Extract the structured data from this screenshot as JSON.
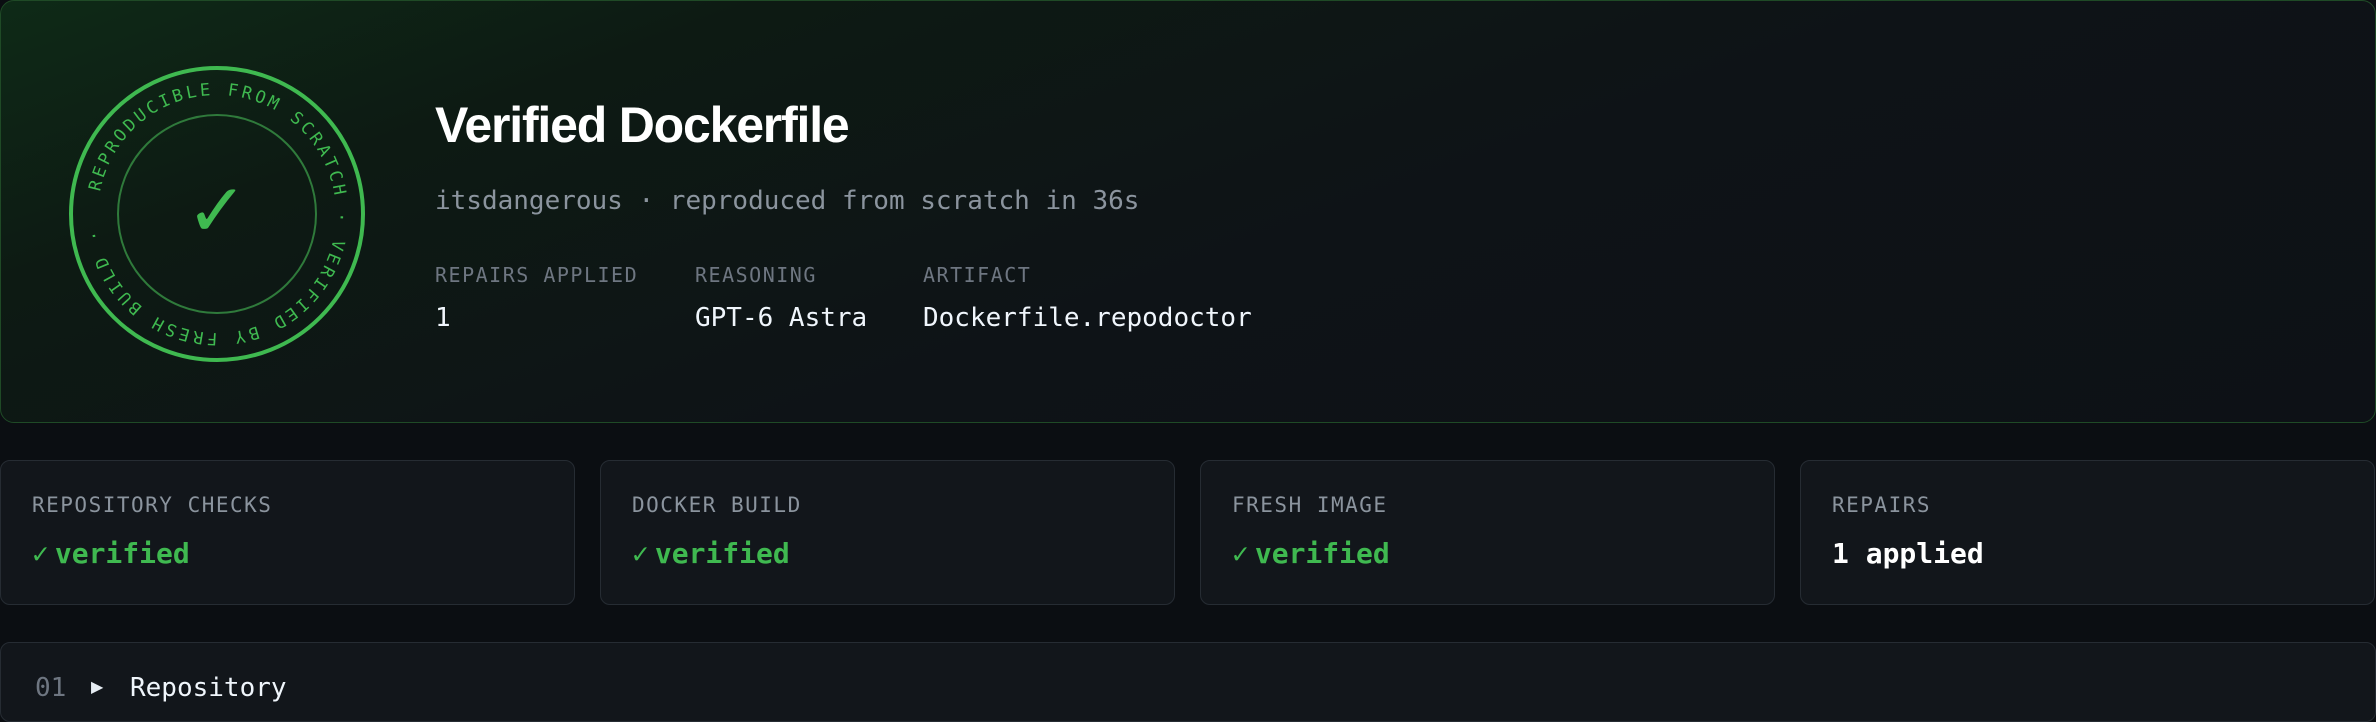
{
  "hero": {
    "seal_text": "REPRODUCIBLE FROM SCRATCH · VERIFIED BY FRESH BUILD ·",
    "title": "Verified Dockerfile",
    "subtitle": "itsdangerous · reproduced from scratch in 36s",
    "meta": [
      {
        "label": "REPAIRS APPLIED",
        "value": "1"
      },
      {
        "label": "REASONING",
        "value": "GPT-6 Astra"
      },
      {
        "label": "ARTIFACT",
        "value": "Dockerfile.repodoctor"
      }
    ]
  },
  "stats": [
    {
      "label": "REPOSITORY CHECKS",
      "check": "✓",
      "value": "verified",
      "status": "ok"
    },
    {
      "label": "DOCKER BUILD",
      "check": "✓",
      "value": "verified",
      "status": "ok"
    },
    {
      "label": "FRESH IMAGE",
      "check": "✓",
      "value": "verified",
      "status": "ok"
    },
    {
      "label": "REPAIRS",
      "check": "",
      "value": "1 applied",
      "status": "plain"
    }
  ],
  "sections": [
    {
      "number": "01",
      "title": "Repository",
      "expanded": false
    }
  ],
  "colors": {
    "accent_green": "#3fb950",
    "background": "#0b0e12",
    "card": "#12161b",
    "muted": "#8b949e"
  }
}
